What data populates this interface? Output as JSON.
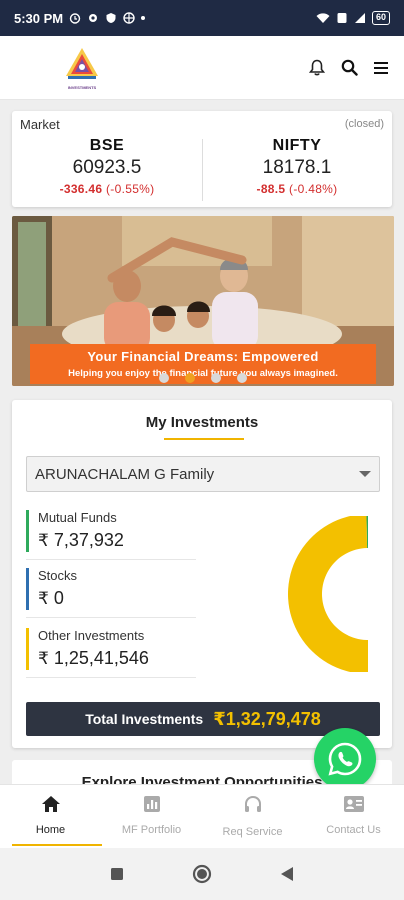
{
  "status_bar": {
    "time": "5:30 PM",
    "battery": "60"
  },
  "header": {
    "logo_text": "INVESTMENTS",
    "icons": [
      "bell-icon",
      "search-icon",
      "menu-icon"
    ]
  },
  "market": {
    "title": "Market",
    "status": "(closed)",
    "bse": {
      "name": "BSE",
      "value": "60923.5",
      "change_points": "-336.46",
      "change_pct": "(-0.55%)"
    },
    "nifty": {
      "name": "NIFTY",
      "value": "18178.1",
      "change_points": "-88.5",
      "change_pct": "(-0.48%)"
    }
  },
  "banner": {
    "headline": "Your Financial Dreams: Empowered",
    "subtext": "Helping you enjoy the financial future you always imagined.",
    "active_slide": 2,
    "slides": 4
  },
  "investments": {
    "title": "My Investments",
    "selected_family": "ARUNACHALAM G Family",
    "items": [
      {
        "label": "Mutual Funds",
        "currency": "₹",
        "value": "7,37,932",
        "color": "#2eaa5c"
      },
      {
        "label": "Stocks",
        "currency": "₹",
        "value": "0",
        "color": "#2f6fb0"
      },
      {
        "label": "Other Investments",
        "currency": "₹",
        "value": "1,25,41,546",
        "color": "#f3c000"
      }
    ],
    "chart_data": {
      "type": "pie",
      "categories": [
        "Mutual Funds",
        "Stocks",
        "Other Investments"
      ],
      "values": [
        737932,
        0,
        12541546
      ],
      "colors": [
        "#2eaa5c",
        "#2f6fb0",
        "#f3c000"
      ]
    },
    "total_label": "Total Investments",
    "total_currency": "₹",
    "total_value": "1,32,79,478"
  },
  "explore": {
    "title": "Explore Investment Opportunities"
  },
  "bottom_nav": {
    "items": [
      {
        "label": "Home",
        "icon": "home-icon",
        "active": true
      },
      {
        "label": "MF Portfolio",
        "icon": "chart-icon",
        "active": false
      },
      {
        "label": "Req Service",
        "icon": "headset-icon",
        "active": false
      },
      {
        "label": "Contact Us",
        "icon": "contact-card-icon",
        "active": false
      }
    ]
  }
}
